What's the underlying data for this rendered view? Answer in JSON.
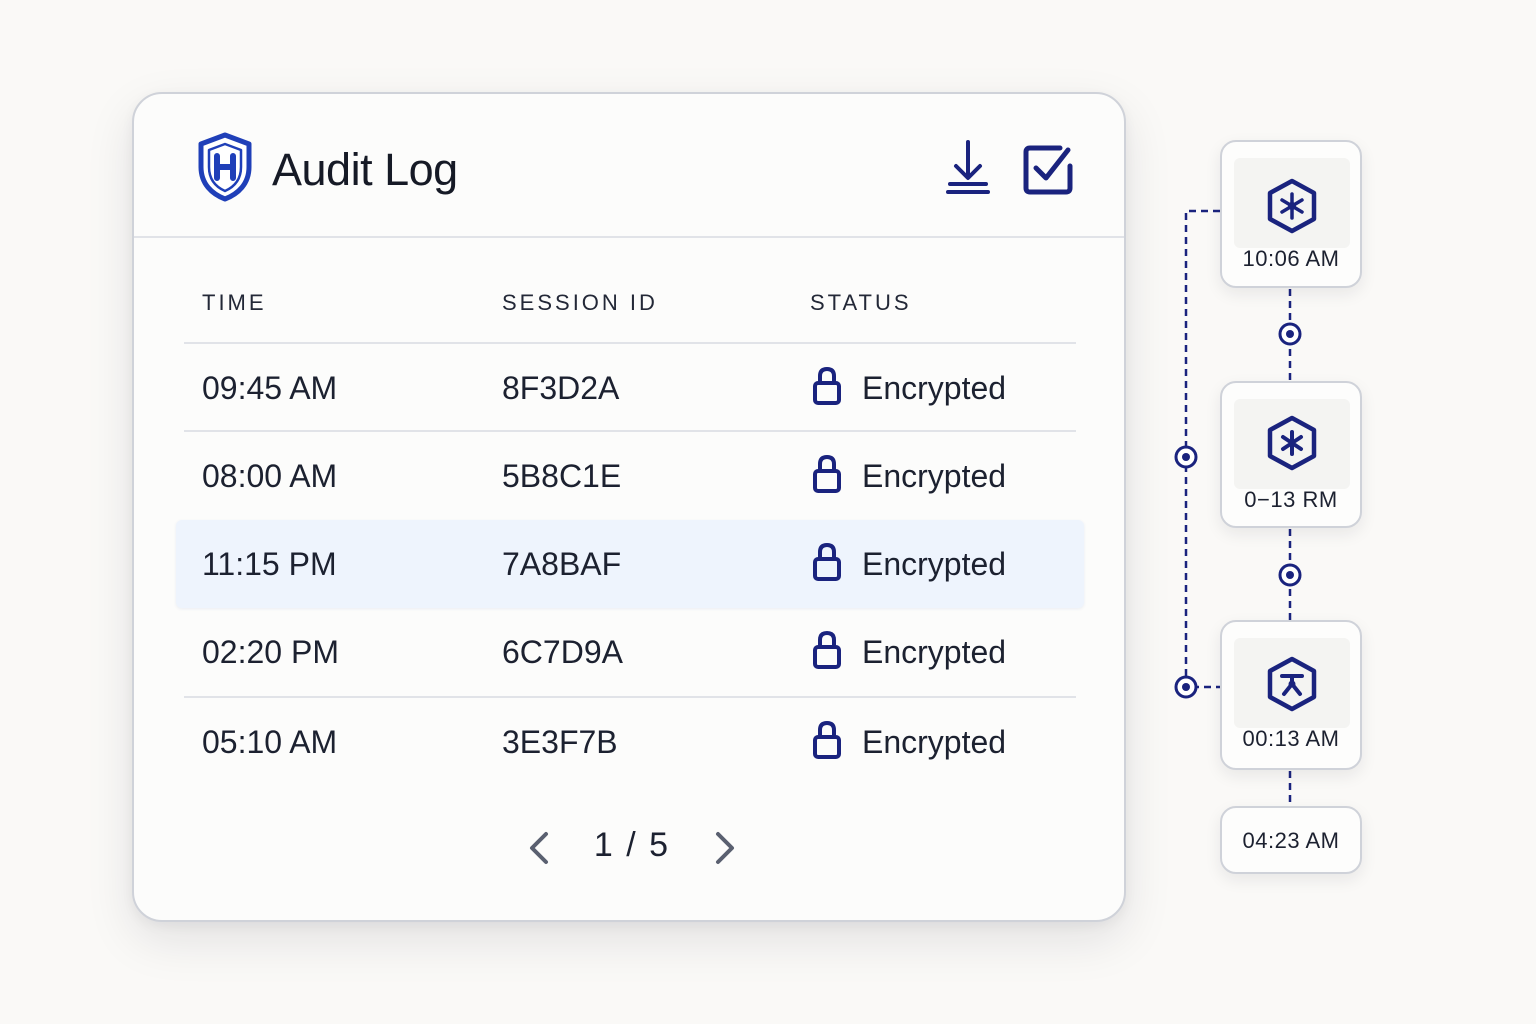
{
  "header": {
    "title": "Audit Log",
    "logo_icon": "shield-h-icon",
    "actions": [
      {
        "name": "download",
        "icon": "download-icon"
      },
      {
        "name": "check",
        "icon": "checkbox-edit-icon"
      }
    ]
  },
  "table": {
    "columns": [
      "TIME",
      "SESSION ID",
      "STATUS"
    ],
    "rows": [
      {
        "time": "09:45 AM",
        "session": "8F3D2A",
        "status": "Encrypted",
        "icon": "lock-icon"
      },
      {
        "time": "08:00 AM",
        "session": "5B8C1E",
        "status": "Encrypted",
        "icon": "lock-icon"
      },
      {
        "time": "11:15 PM",
        "session": "7A8BAF",
        "status": "Encrypted",
        "icon": "lock-icon",
        "selected": true
      },
      {
        "time": "02:20 PM",
        "session": "6C7D9A",
        "status": "Encrypted",
        "icon": "lock-icon"
      },
      {
        "time": "05:10 AM",
        "session": "3E3F7B",
        "status": "Encrypted",
        "icon": "lock-icon"
      }
    ]
  },
  "pagination": {
    "text": "1 / 5",
    "current": 1,
    "total": 5
  },
  "timeline": {
    "nodes": [
      {
        "time": "10:06 AM",
        "icon": "hex-node-icon"
      },
      {
        "time": "0−13 RM",
        "icon": "hex-asterisk-icon"
      },
      {
        "time": "00:13 AM",
        "icon": "hex-figure-icon"
      },
      {
        "time": "04:23 AM"
      }
    ]
  },
  "colors": {
    "accent": "#1a237e",
    "logo_blue": "#1f3fb8",
    "selected_row": "#eef4fd",
    "border": "#cfd2d9"
  }
}
